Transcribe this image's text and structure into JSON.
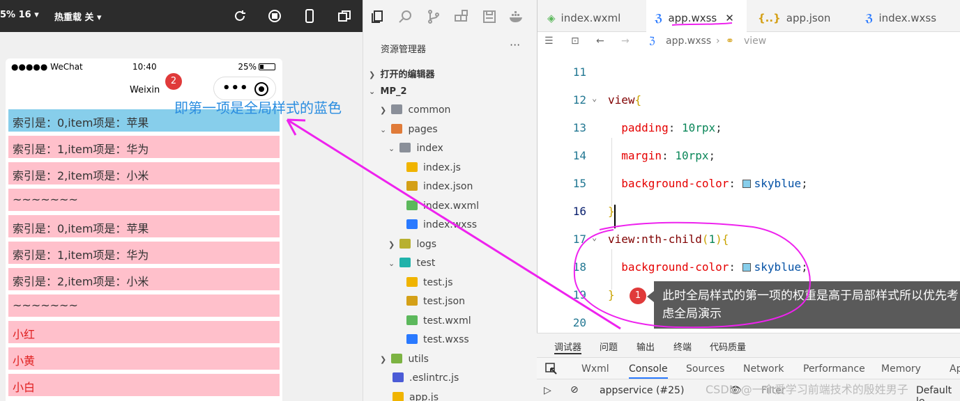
{
  "simulator": {
    "toolbar": {
      "zoom": "5% 16 ▾",
      "hot_reload": "热重载 关 ▾"
    },
    "status": {
      "carrier": "●●●●● WeChat",
      "time": "10:40",
      "battery": "25%"
    },
    "nav_title": "Weixin",
    "list": [
      {
        "text": "索引是：0,item项是：苹果",
        "style": "blue"
      },
      {
        "text": "索引是：1,item项是：华为",
        "style": "pink"
      },
      {
        "text": "索引是：2,item项是：小米",
        "style": "pink"
      },
      {
        "text": "~~~~~~~",
        "style": "pink"
      },
      {
        "text": "索引是：0,item项是：苹果",
        "style": "pink"
      },
      {
        "text": "索引是：1,item项是：华为",
        "style": "pink"
      },
      {
        "text": "索引是：2,item项是：小米",
        "style": "pink"
      },
      {
        "text": "~~~~~~~",
        "style": "pink"
      },
      {
        "text": "小红",
        "style": "red"
      },
      {
        "text": "小黄",
        "style": "red"
      },
      {
        "text": "小白",
        "style": "red"
      }
    ],
    "annotation_2": "即第一项是全局样式的蓝色",
    "badge_2": "2"
  },
  "explorer": {
    "title": "资源管理器",
    "more": "···",
    "open_editors": "打开的编辑器",
    "project": "MP_2",
    "tree": [
      "common",
      "pages",
      "index",
      "index.js",
      "index.json",
      "index.wxml",
      "index.wxss",
      "logs",
      "test",
      "test.js",
      "test.json",
      "test.wxml",
      "test.wxss",
      "utils",
      ".eslintrc.js",
      "app.js"
    ]
  },
  "editor": {
    "tabs": [
      "index.wxml",
      "app.wxss",
      "app.json",
      "index.wxss"
    ],
    "breadcrumb": {
      "file": "app.wxss",
      "symbol": "view"
    },
    "lines": [
      {
        "n": "11"
      },
      {
        "n": "12",
        "sel": "view",
        "brace": "{"
      },
      {
        "n": "13",
        "prop": "padding",
        "val": "10rpx"
      },
      {
        "n": "14",
        "prop": "margin",
        "val": "10rpx"
      },
      {
        "n": "15",
        "prop": "background-color",
        "val": "skyblue"
      },
      {
        "n": "16",
        "brace": "}"
      },
      {
        "n": "17",
        "sel": "view:nth-child",
        "arg": "1",
        "brace": "{"
      },
      {
        "n": "18",
        "prop": "background-color",
        "val": "skyblue"
      },
      {
        "n": "19",
        "brace": "}"
      },
      {
        "n": "20"
      }
    ],
    "callout_1": "此时全局样式的第一项的权重是高于局部样式所以优先考虑全局演示",
    "badge_1": "1"
  },
  "debugger": {
    "top_tabs": [
      "调试器",
      "问题",
      "输出",
      "终端",
      "代码质量"
    ],
    "panel_tabs": [
      "Wxml",
      "Console",
      "Sources",
      "Network",
      "Performance",
      "Memory",
      "App"
    ],
    "active_panel": "Console",
    "context": "appservice (#25)",
    "filter_placeholder": "Filter",
    "levels": "Default le"
  },
  "watermark": "CSDN @一个爱学习前端技术的殷姓男子",
  "colors": {
    "skyblue": "#87ceeb",
    "pink": "#ffc0cb",
    "annotation": "#ee22ee",
    "badge": "#e03a3a"
  }
}
